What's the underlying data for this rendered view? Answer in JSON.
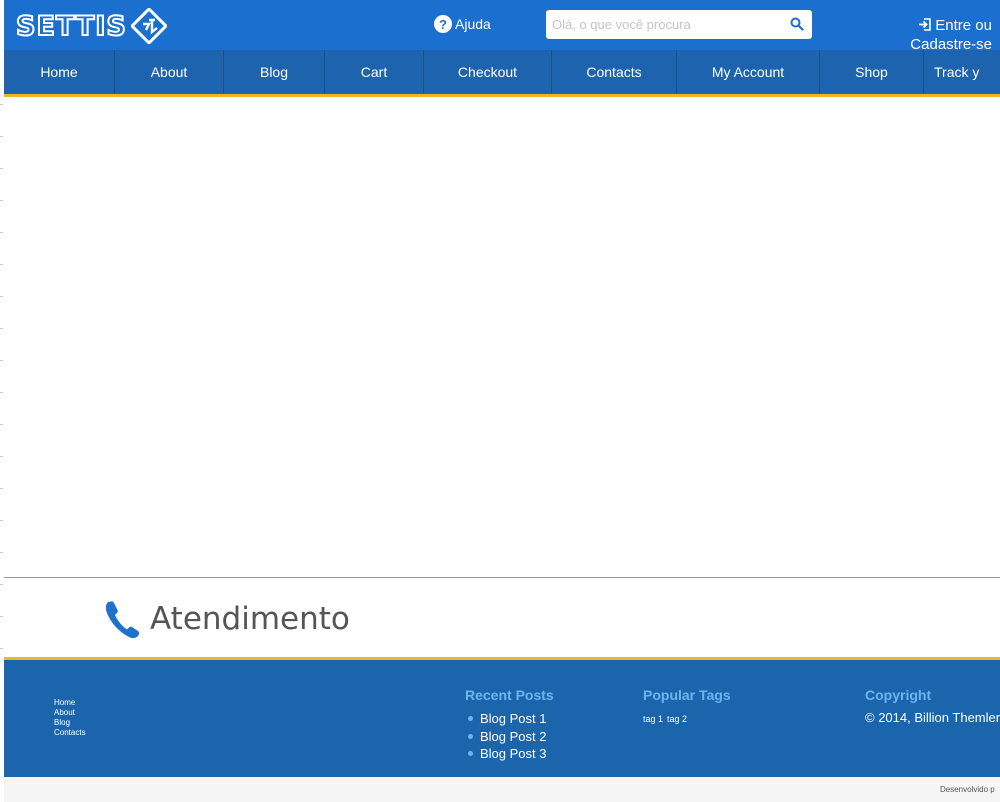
{
  "header": {
    "logo_text": "SETTIS",
    "help_label": "Ajuda",
    "search_placeholder": "Olá, o que você procura",
    "login_label": "Entre ou Cadastre-se",
    "colors": {
      "topbar": "#1a6fcf",
      "nav": "#1e63ad",
      "accent": "#f0b428"
    }
  },
  "nav": {
    "items": [
      {
        "label": "Home"
      },
      {
        "label": "About"
      },
      {
        "label": "Blog"
      },
      {
        "label": "Cart"
      },
      {
        "label": "Checkout"
      },
      {
        "label": "Contacts"
      },
      {
        "label": "My Account"
      },
      {
        "label": "Shop"
      },
      {
        "label": "Track y"
      }
    ]
  },
  "atendimento": {
    "title": "Atendimento"
  },
  "footer": {
    "links": [
      "Home",
      "About",
      "Blog",
      "Contacts"
    ],
    "recent_posts": {
      "title": "Recent Posts",
      "items": [
        "Blog Post 1",
        "Blog Post 2",
        "Blog Post 3"
      ]
    },
    "popular_tags": {
      "title": "Popular Tags",
      "tags": [
        "tag 1",
        "tag 2"
      ]
    },
    "copyright": {
      "title": "Copyright",
      "text": "© 2014, Billion Themler"
    },
    "developed_by": "Desenvolvido p"
  }
}
